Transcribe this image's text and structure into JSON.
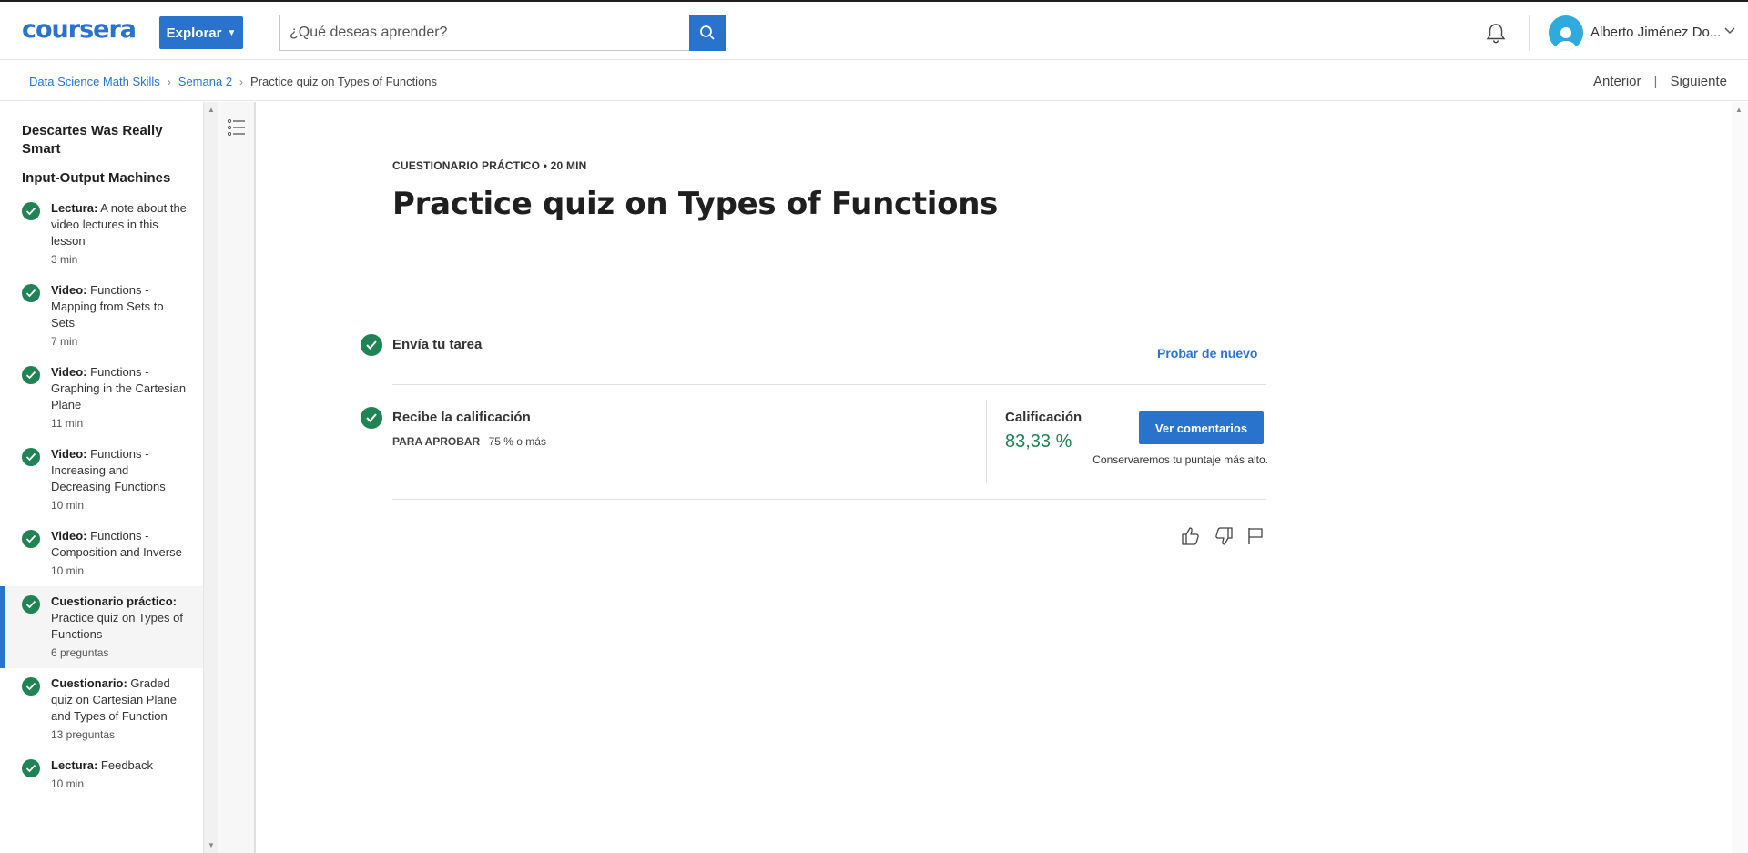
{
  "header": {
    "logo": "coursera",
    "explore_label": "Explorar",
    "search_placeholder": "¿Qué deseas aprender?",
    "user_name": "Alberto Jiménez Do...",
    "accent_color": "#2a73cc"
  },
  "breadcrumb": {
    "items": [
      "Data Science Math Skills",
      "Semana 2"
    ],
    "current": "Practice quiz on Types of Functions"
  },
  "pager": {
    "prev": "Anterior",
    "next": "Siguiente"
  },
  "sidebar": {
    "sections": [
      "Descartes Was Really Smart",
      "Input-Output Machines"
    ],
    "items": [
      {
        "kind": "Lectura:",
        "title": "A note about the video lectures in this lesson",
        "meta": "3 min",
        "completed": true
      },
      {
        "kind": "Video:",
        "title": "Functions - Mapping from Sets to Sets",
        "meta": "7 min",
        "completed": true
      },
      {
        "kind": "Video:",
        "title": "Functions - Graphing in the Cartesian Plane",
        "meta": "11 min",
        "completed": true
      },
      {
        "kind": "Video:",
        "title": "Functions - Increasing and Decreasing Functions",
        "meta": "10 min",
        "completed": true
      },
      {
        "kind": "Video:",
        "title": "Functions - Composition and Inverse",
        "meta": "10 min",
        "completed": true
      },
      {
        "kind": "Cuestionario práctico:",
        "title": "Practice quiz on Types of Functions",
        "meta": "6 preguntas",
        "completed": true,
        "active": true
      },
      {
        "kind": "Cuestionario:",
        "title": "Graded quiz on Cartesian Plane and Types of Function",
        "meta": "13 preguntas",
        "completed": true
      },
      {
        "kind": "Lectura:",
        "title": "Feedback",
        "meta": "10 min",
        "completed": true
      }
    ]
  },
  "main": {
    "eyebrow": "CUESTIONARIO PRÁCTICO • 20 MIN",
    "title": "Practice quiz on Types of Functions",
    "step1": {
      "label": "Envía tu tarea",
      "action": "Probar de nuevo"
    },
    "step2": {
      "label": "Recibe la calificación",
      "pass_label": "PARA APROBAR",
      "pass_value": "75 % o más",
      "grade_label": "Calificación",
      "grade_value": "83,33 %",
      "feedback_button": "Ver comentarios",
      "note": "Conservaremos tu puntaje más alto."
    },
    "success_color": "#1f8354"
  }
}
